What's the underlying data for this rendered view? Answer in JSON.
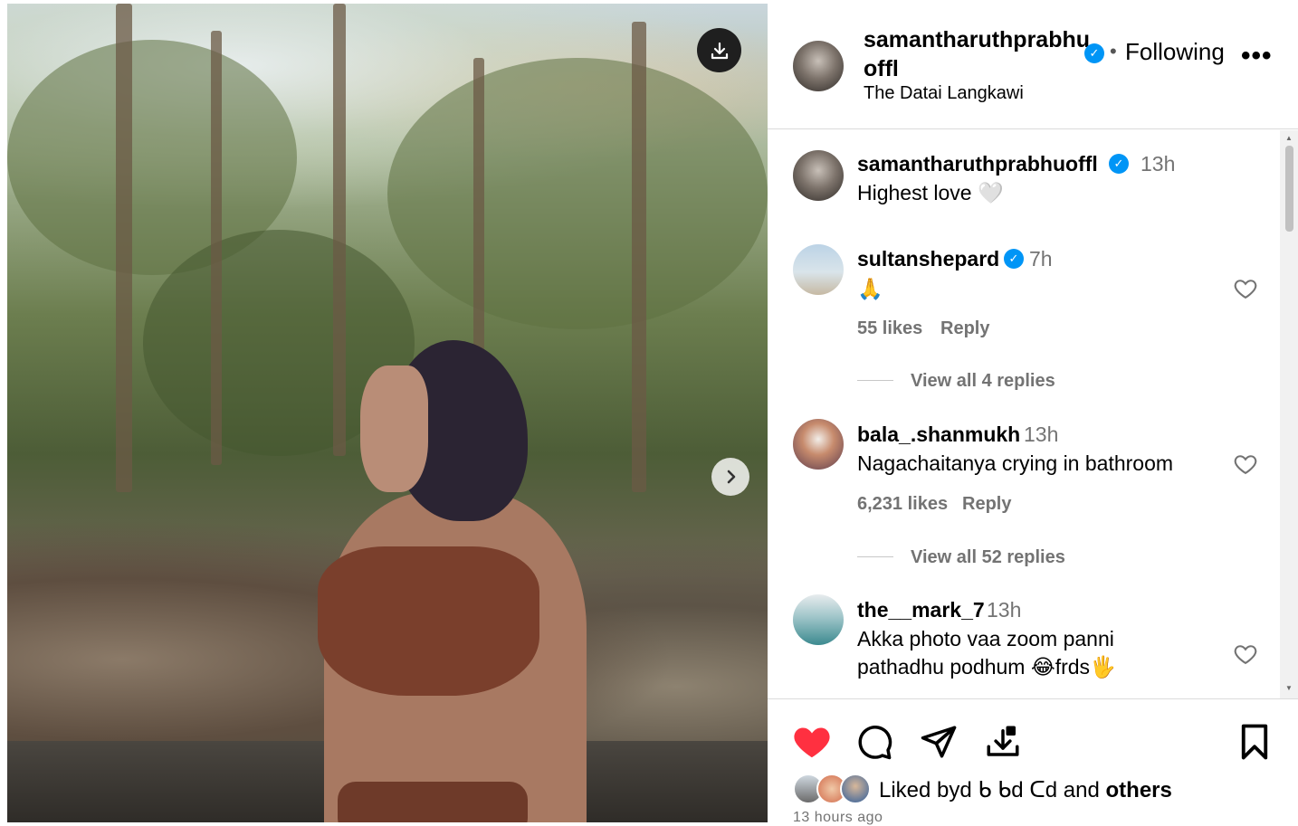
{
  "post": {
    "username": "samantharuthprabhuoffl",
    "username_display": "samantharuthprabhu offl",
    "location": "The Datai Langkawi",
    "follow_status": "Following",
    "dot": "•",
    "more": "•••"
  },
  "comments": [
    {
      "user": "samantharuthprabhuoffl",
      "verified": true,
      "time": "13h",
      "text": "Highest love 🤍",
      "likes": "",
      "reply": "",
      "view_replies": ""
    },
    {
      "user": "sultanshepard",
      "verified": true,
      "time": "7h",
      "text": "🙏",
      "likes": "55 likes",
      "reply": "Reply",
      "view_replies": "View all 4 replies"
    },
    {
      "user": "bala_.shanmukh",
      "verified": false,
      "time": "13h",
      "text": "Nagachaitanya crying in bathroom",
      "likes": "6,231 likes",
      "reply": "Reply",
      "view_replies": "View all 52 replies"
    },
    {
      "user": "the__mark_7",
      "verified": false,
      "time": "13h",
      "text_line1": "Akka photo vaa zoom panni",
      "text_line2": "pathadhu podhum 😂frds🖐"
    }
  ],
  "likes": {
    "prefix": "Liked by",
    "names": "d ᑲ ᑲd ᑕd",
    "conjunction": "and",
    "others": "others"
  },
  "time_ago": "13 hours ago",
  "colors": {
    "verified": "#0095f6",
    "like_active": "#ff3040",
    "muted": "#737373"
  },
  "icons": [
    "download-icon",
    "chevron-right-icon",
    "more-icon",
    "heart-icon",
    "comment-icon",
    "share-icon",
    "save-icon",
    "bookmark-icon"
  ]
}
